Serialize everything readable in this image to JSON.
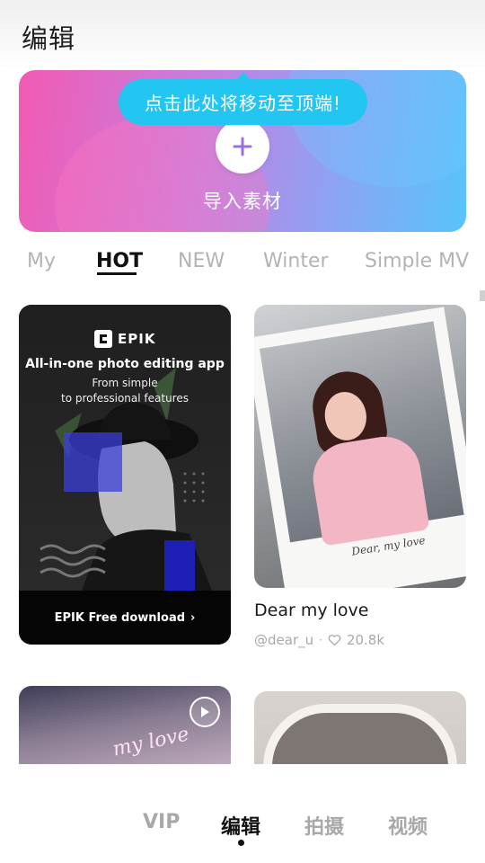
{
  "header": {
    "title": "编辑"
  },
  "banner": {
    "tooltip": "点击此处将移动至顶端!",
    "import_label": "导入素材",
    "colors": {
      "start": "#f25ab3",
      "end": "#58c4fb"
    }
  },
  "tabs": [
    {
      "label": "My",
      "active": false
    },
    {
      "label": "HOT",
      "active": true
    },
    {
      "label": "NEW",
      "active": false
    },
    {
      "label": "Winter",
      "active": false
    },
    {
      "label": "Simple MV",
      "active": false
    }
  ],
  "ad": {
    "brand": "EPIK",
    "headline": "All-in-one photo editing app",
    "sub1": "From simple",
    "sub2": "to professional features",
    "cta": "EPIK Free download"
  },
  "template_card": {
    "title": "Dear my love",
    "author": "@dear_u",
    "likes": "20.8k",
    "signature": "Dear, my love"
  },
  "video_card": {
    "neon_text": "my love"
  },
  "bottom_nav": [
    {
      "label": "VIP",
      "active": false
    },
    {
      "label": "编辑",
      "active": true
    },
    {
      "label": "拍摄",
      "active": false
    },
    {
      "label": "视频",
      "active": false
    }
  ]
}
